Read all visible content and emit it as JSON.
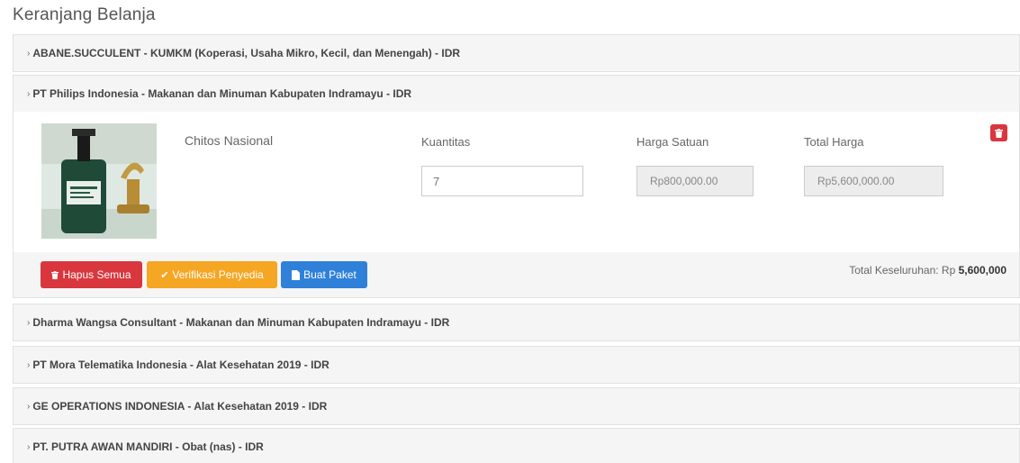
{
  "page": {
    "title": "Keranjang Belanja"
  },
  "vendors": [
    {
      "label": "ABANE.SUCCULENT - KUMKM (Koperasi, Usaha Mikro, Kecil, dan Menengah) - IDR"
    },
    {
      "label": "PT Philips Indonesia - Makanan dan Minuman Kabupaten Indramayu - IDR"
    },
    {
      "label": "Dharma Wangsa Consultant - Makanan dan Minuman Kabupaten Indramayu - IDR"
    },
    {
      "label": "PT Mora Telematika Indonesia - Alat Kesehatan 2019 - IDR"
    },
    {
      "label": "GE OPERATIONS INDONESIA - Alat Kesehatan 2019 - IDR"
    },
    {
      "label": "PT. PUTRA AWAN MANDIRI - Obat (nas) - IDR"
    }
  ],
  "cart_item": {
    "name": "Chitos Nasional",
    "qty_label": "Kuantitas",
    "qty_value": "7",
    "unit_price_label": "Harga Satuan",
    "unit_price": "Rp800,000.00",
    "total_label": "Total Harga",
    "total": "Rp5,600,000.00"
  },
  "actions": {
    "delete_all": "Hapus Semua",
    "verify": "Verifikasi Penyedia",
    "create_package": "Buat Paket",
    "grand_total_label": "Total Keseluruhan: Rp",
    "grand_total": "5,600,000"
  },
  "icons": {
    "chevron": "chevron-right-icon",
    "trash": "trash-icon",
    "check": "check-icon",
    "file": "file-icon"
  },
  "colors": {
    "danger": "#d9363e",
    "warning": "#f5a623",
    "primary": "#2f80d9",
    "panel_bg": "#f5f5f5"
  }
}
